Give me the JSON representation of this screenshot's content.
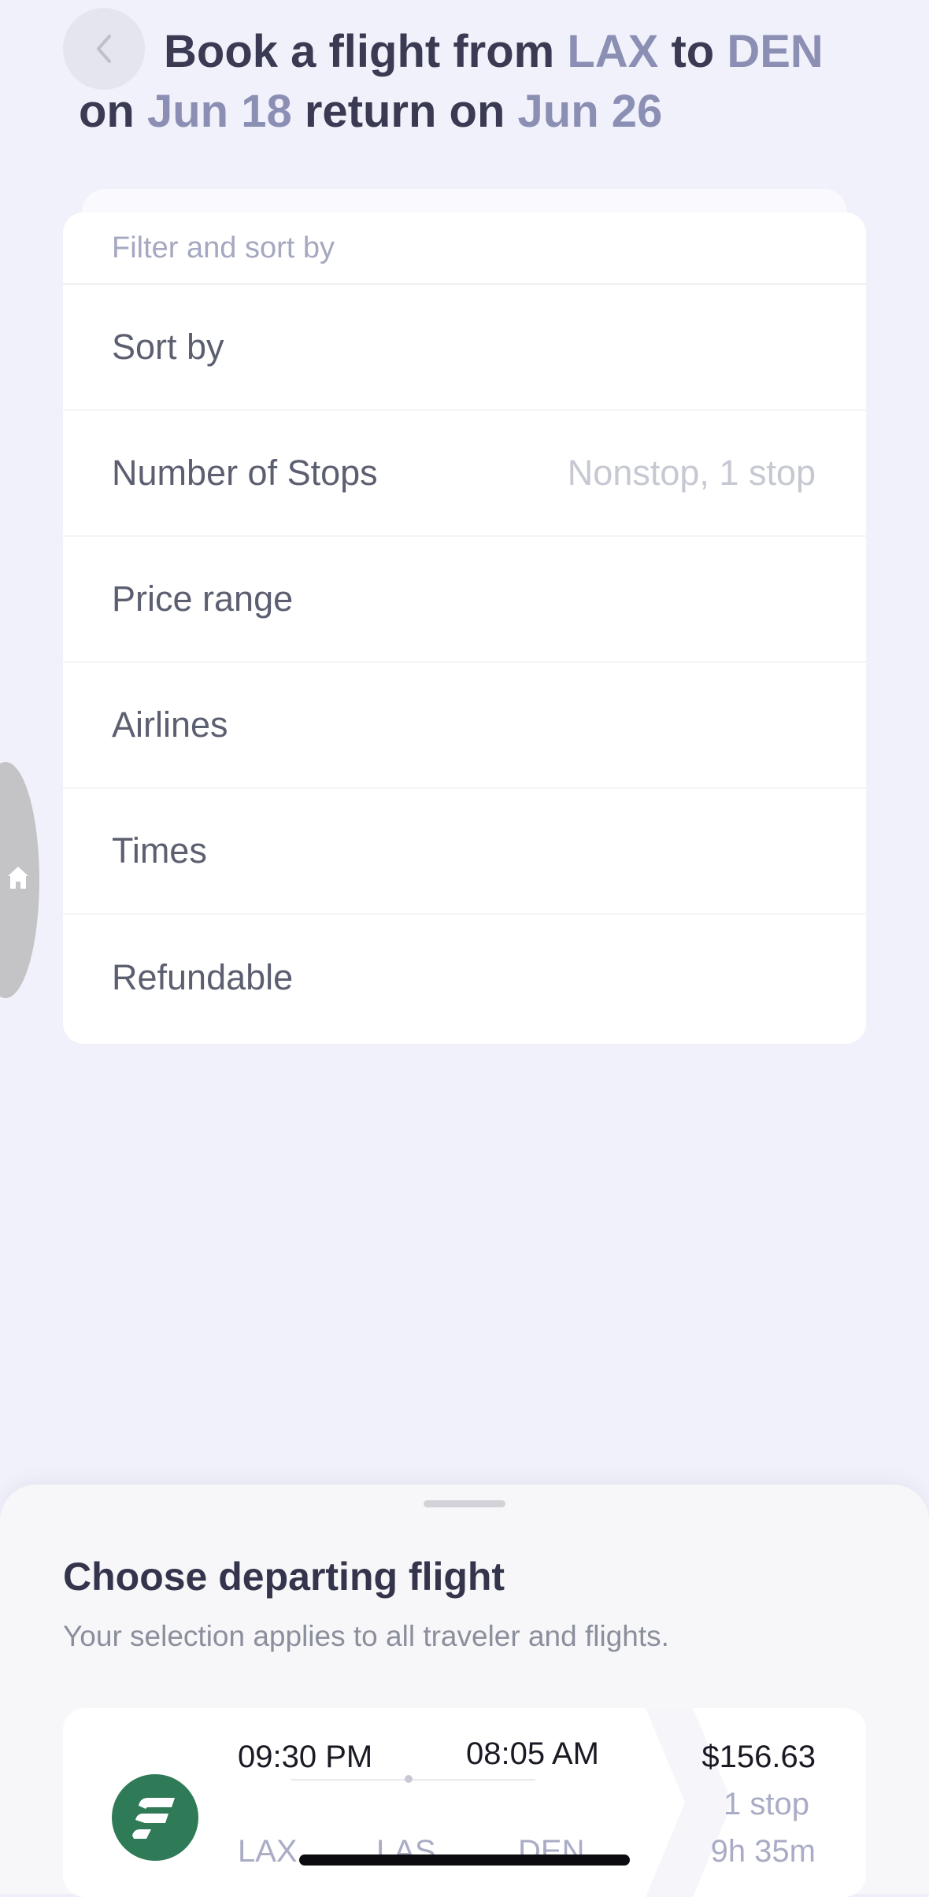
{
  "header": {
    "title_prefix": "Book a flight from",
    "origin": "LAX",
    "to_word": "to",
    "destination": "DEN",
    "on_word": "on",
    "depart_date": "Jun 18",
    "return_word": "return on",
    "return_date": "Jun 26",
    "back_icon": "chevron-left-icon"
  },
  "filter": {
    "header": "Filter and sort by",
    "rows": [
      {
        "label": "Sort by",
        "value": ""
      },
      {
        "label": "Number of Stops",
        "value": "Nonstop, 1 stop"
      },
      {
        "label": "Price range",
        "value": ""
      },
      {
        "label": "Airlines",
        "value": ""
      },
      {
        "label": "Times",
        "value": ""
      },
      {
        "label": "Refundable",
        "value": ""
      }
    ]
  },
  "side_handle": {
    "icon": "home-icon"
  },
  "sheet": {
    "title": "Choose departing flight",
    "subtitle": "Your selection applies to all traveler and flights.",
    "flights": [
      {
        "depart_time": "09:30 PM",
        "arrive_time": "08:05 AM",
        "origin": "LAX",
        "stop": "LAS",
        "destination": "DEN",
        "price": "$156.63",
        "stops": "1 stop",
        "duration": "9h 35m",
        "logo_color": "#2f7a57"
      }
    ]
  },
  "colors": {
    "background": "#f0f1fa",
    "accent_text": "#8c8fb4",
    "title_text": "#3a3b52"
  }
}
